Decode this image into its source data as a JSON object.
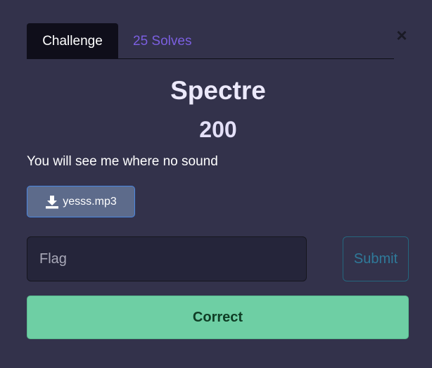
{
  "modal": {
    "close_label": "×"
  },
  "tabs": [
    {
      "label": "Challenge",
      "active": true
    },
    {
      "label": "25 Solves",
      "active": false
    }
  ],
  "challenge": {
    "name": "Spectre",
    "points": "200",
    "description": "You will see me where no sound",
    "file": {
      "label": "yesss.mp3",
      "icon": "download-icon"
    }
  },
  "form": {
    "flag_placeholder": "Flag",
    "flag_value": "",
    "submit_label": "Submit"
  },
  "result": {
    "message": "Correct",
    "status_color": "#6ecfa4"
  },
  "colors": {
    "background": "#33324b",
    "accent_purple": "#7b5fe0",
    "file_button": "#5d6b8b"
  }
}
